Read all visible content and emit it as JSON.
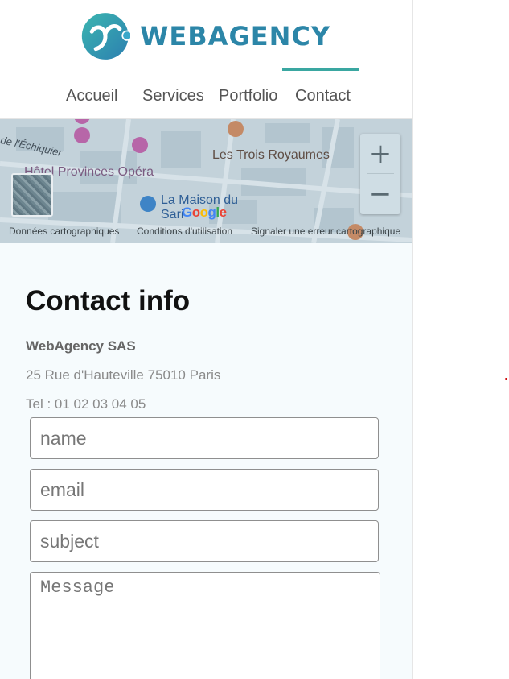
{
  "brand": {
    "name": "WEBAGENCY"
  },
  "nav": {
    "items": [
      {
        "label": "Accueil"
      },
      {
        "label": "Services"
      },
      {
        "label": "Portfolio"
      },
      {
        "label": "Contact"
      }
    ],
    "active": "Contact"
  },
  "map": {
    "places": [
      "Hôtel Provinces Opéra",
      "Les Trois Royaumes",
      "La Maison du",
      "Sari",
      "de l'Échiquier"
    ],
    "logo": "Google",
    "zoom_in": "+",
    "zoom_out": "−",
    "footer": {
      "data": "Données cartographiques",
      "terms": "Conditions d'utilisation",
      "report": "Signaler une erreur cartographique"
    }
  },
  "contact": {
    "title": "Contact info",
    "company": "WebAgency SAS",
    "address": "25 Rue d'Hauteville 75010 Paris",
    "tel": "Tel : 01 02 03 04 05",
    "placeholders": {
      "name": "name",
      "email": "email",
      "subject": "subject",
      "message": "Message"
    }
  },
  "colors": {
    "brand": "#2c86a8",
    "accent": "#3aa7a1",
    "section_bg": "#f6fbfd"
  }
}
